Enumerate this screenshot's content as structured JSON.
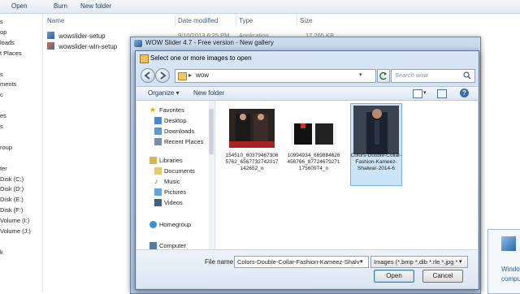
{
  "explorer": {
    "toolbar": {
      "open": "Open",
      "burn": "Burn",
      "new_folder": "New folder"
    },
    "left_items": [
      "s",
      "op",
      "loads",
      "t Places",
      "",
      "s",
      "ments",
      "c",
      "",
      "es",
      "s",
      "",
      "roup",
      "",
      "ter",
      "Disk (C:)",
      "Disk (D:)",
      "Disk (E:)",
      "Disk (F:)",
      "Volume (I:)",
      "Volume (J:)",
      "",
      "k"
    ],
    "columns": {
      "name": "Name",
      "date": "Date modified",
      "type": "Type",
      "size": "Size"
    },
    "files": [
      {
        "name": "wowslider-setup",
        "date": "9/10/2013 6:25 PM",
        "type": "Application",
        "size": "17,265 KB"
      },
      {
        "name": "wowslider-win-setup",
        "date": "",
        "type": "",
        "size": ""
      }
    ]
  },
  "wow_window": {
    "title": "WOW Slider 4.7 - Free version - New gallery"
  },
  "dialog": {
    "title": "Select one or more images to open",
    "address": {
      "folder": "wow",
      "search_placeholder": "Search wow"
    },
    "commands": {
      "organize": "Organize ▾",
      "new_folder": "New folder"
    },
    "nav": {
      "favorites": "Favorites",
      "desktop": "Desktop",
      "downloads": "Downloads",
      "recent_places": "Recent Places",
      "libraries": "Libraries",
      "documents": "Documents",
      "music": "Music",
      "pictures": "Pictures",
      "videos": "Videos",
      "homegroup": "Homegroup",
      "computer": "Computer"
    },
    "files": [
      {
        "label": "154510_603794673065762_6567732742017142652_n"
      },
      {
        "label": "10994934_669884626456766_8772467927117560974_n"
      },
      {
        "label": "Colors-Double-Collar-Fashion-Kameez-Shalwar-2014-6"
      }
    ],
    "file_name_label": "File name:",
    "file_name_value": "Colors-Double-Collar-Fashion-Kameez-Shalv",
    "file_type": "Images (*.bmp *.dib *.rle *.jpg *",
    "open_label": "Open",
    "cancel_label": "Cancel"
  },
  "right_window": {
    "text1": "Windo",
    "text2": "compu"
  },
  "colors": {
    "accent": "#3a6ea5",
    "selection": "#cce4f7",
    "title_bar": "#c3d6ec"
  }
}
